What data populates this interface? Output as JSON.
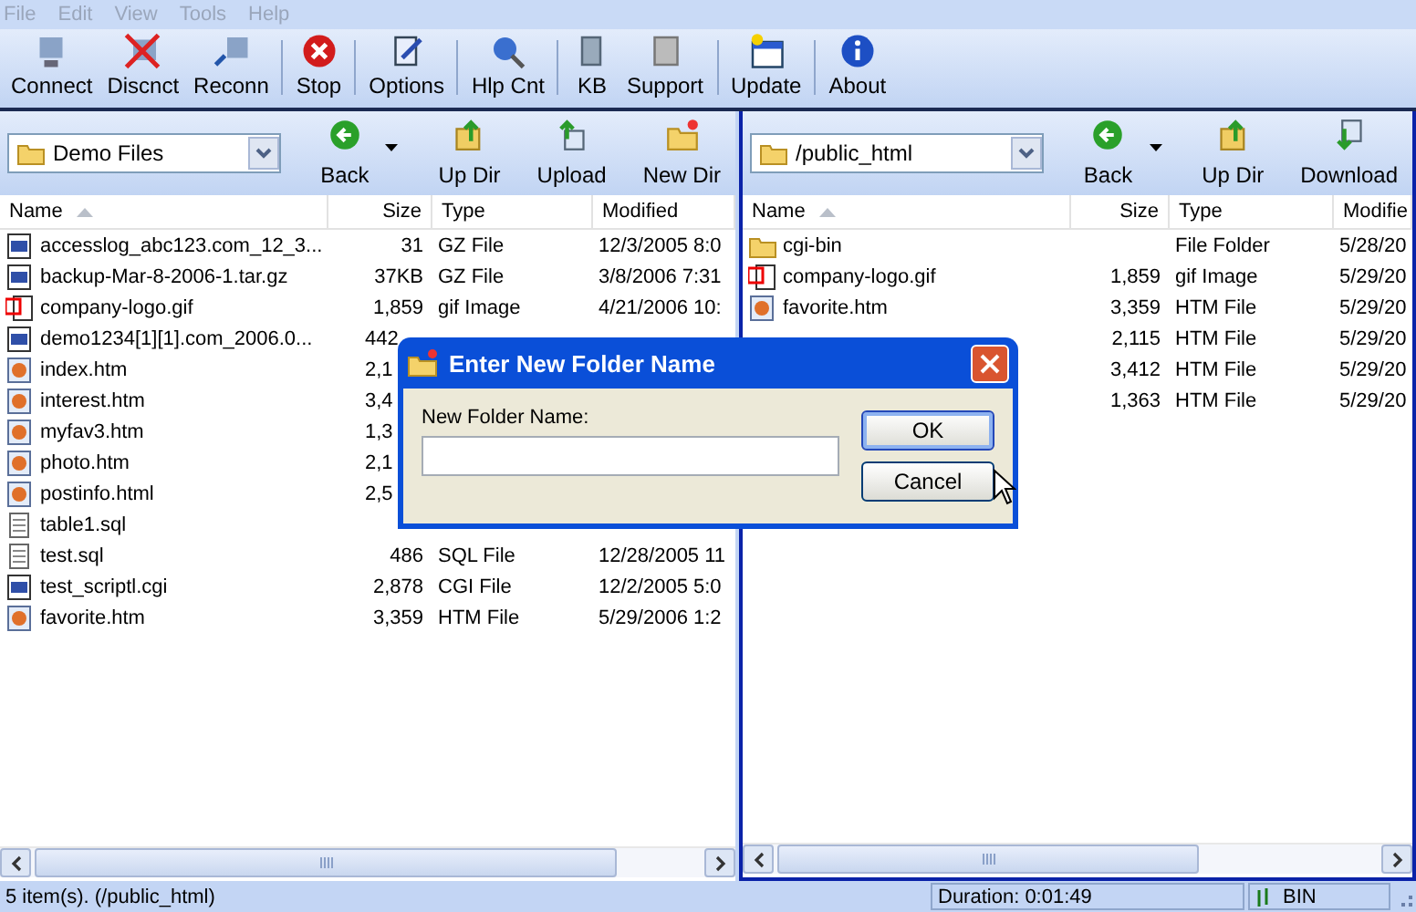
{
  "menu": [
    {
      "label": "File",
      "disabled": true
    },
    {
      "label": "Edit",
      "disabled": true
    },
    {
      "label": "View",
      "disabled": true
    },
    {
      "label": "Tools",
      "disabled": true
    },
    {
      "label": "Help",
      "disabled": true
    }
  ],
  "toolbar": [
    {
      "label": "Connect",
      "separator_after": false
    },
    {
      "label": "Discnct",
      "separator_after": false
    },
    {
      "label": "Reconn",
      "separator_after": true
    },
    {
      "label": "Stop",
      "separator_after": true
    },
    {
      "label": "Options",
      "separator_after": true
    },
    {
      "label": "Hlp Cnt",
      "separator_after": true
    },
    {
      "label": "KB",
      "separator_after": false
    },
    {
      "label": "Support",
      "separator_after": true
    },
    {
      "label": "Update",
      "separator_after": true
    },
    {
      "label": "About",
      "separator_after": false
    }
  ],
  "left_pane": {
    "active": false,
    "location": "Demo Files",
    "buttons": [
      {
        "label": "Back",
        "dropdown": true
      },
      {
        "label": "Up Dir",
        "dropdown": false
      },
      {
        "label": "Upload",
        "dropdown": false
      },
      {
        "label": "New Dir",
        "dropdown": false
      }
    ],
    "columns": [
      "Name",
      "Size",
      "Type",
      "Modified"
    ],
    "rows": [
      {
        "kind": "archive",
        "name": "accesslog_abc123.com_12_3...",
        "size": "31",
        "type": "GZ File",
        "modified": "12/3/2005 8:0"
      },
      {
        "kind": "archive",
        "name": "backup-Mar-8-2006-1.tar.gz",
        "size": "37KB",
        "type": "GZ File",
        "modified": "3/8/2006 7:31"
      },
      {
        "kind": "image",
        "name": "company-logo.gif",
        "size": "1,859",
        "type": "gif Image",
        "modified": "4/21/2006 10:"
      },
      {
        "kind": "archive",
        "name": "demo1234[1][1].com_2006.0...",
        "size": "442"
      },
      {
        "kind": "web",
        "name": "index.htm",
        "size": "2,1"
      },
      {
        "kind": "web",
        "name": "interest.htm",
        "size": "3,4"
      },
      {
        "kind": "web",
        "name": "myfav3.htm",
        "size": "1,3"
      },
      {
        "kind": "web",
        "name": "photo.htm",
        "size": "2,1"
      },
      {
        "kind": "web",
        "name": "postinfo.html",
        "size": "2,5"
      },
      {
        "kind": "text",
        "name": "table1.sql"
      },
      {
        "kind": "text",
        "name": "test.sql",
        "size": "486",
        "type": "SQL File",
        "modified": "12/28/2005 11"
      },
      {
        "kind": "archive",
        "name": "test_scriptl.cgi",
        "size": "2,878",
        "type": "CGI File",
        "modified": "12/2/2005 5:0"
      },
      {
        "kind": "web",
        "name": "favorite.htm",
        "size": "3,359",
        "type": "HTM File",
        "modified": "5/29/2006 1:2"
      }
    ]
  },
  "right_pane": {
    "active": true,
    "location": "/public_html",
    "buttons": [
      {
        "label": "Back",
        "dropdown": true
      },
      {
        "label": "Up Dir",
        "dropdown": false
      },
      {
        "label": "Download",
        "dropdown": false
      }
    ],
    "columns": [
      "Name",
      "Size",
      "Type",
      "Modifie"
    ],
    "rows": [
      {
        "kind": "folder",
        "name": "cgi-bin",
        "type": "File Folder",
        "modified": "5/28/20"
      },
      {
        "kind": "image",
        "name": "company-logo.gif",
        "size": "1,859",
        "type": "gif Image",
        "modified": "5/29/20"
      },
      {
        "kind": "web",
        "name": "favorite.htm",
        "size": "3,359",
        "type": "HTM File",
        "modified": "5/29/20"
      },
      {
        "kind": "none",
        "size": "2,115",
        "type": "HTM File",
        "modified": "5/29/20"
      },
      {
        "kind": "none",
        "size": "3,412",
        "type": "HTM File",
        "modified": "5/29/20"
      },
      {
        "kind": "none",
        "size": "1,363",
        "type": "HTM File",
        "modified": "5/29/20"
      }
    ]
  },
  "dialog": {
    "title": "Enter New Folder Name",
    "label": "New Folder Name:",
    "buttons": [
      {
        "label": "OK",
        "selected": true
      },
      {
        "label": "Cancel",
        "selected": false
      }
    ]
  },
  "status_bar": {
    "items": "5 item(s).  (/public_html)",
    "duration": "Duration: 0:01:49",
    "mode": "BIN"
  }
}
